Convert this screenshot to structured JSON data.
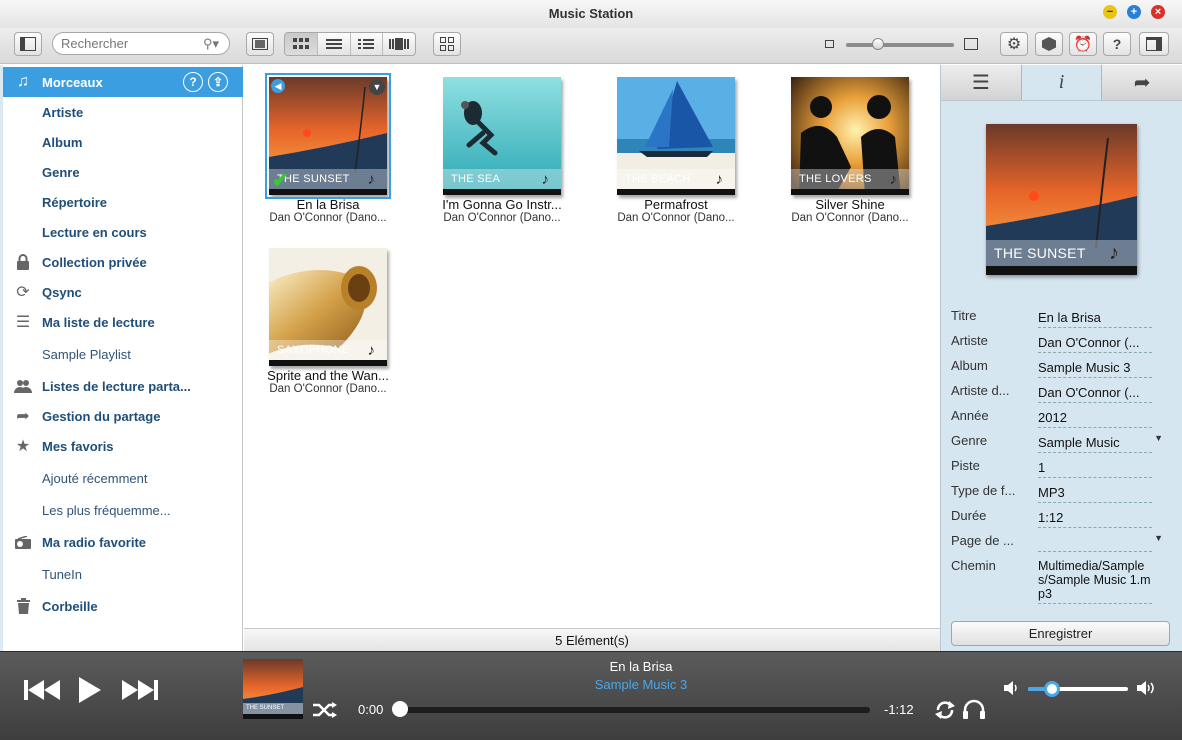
{
  "window": {
    "title": "Music Station"
  },
  "toolbar": {
    "search_placeholder": "Rechercher",
    "view_modes": [
      "thumbnail-view",
      "list-view",
      "detail-list-view",
      "cover-flow-view"
    ],
    "active_view": "thumbnail-view",
    "zoom_level": 0.3
  },
  "sidebar": {
    "items": [
      {
        "label": "Morceaux",
        "icon": "music-note-icon",
        "active": true
      },
      {
        "label": "Artiste"
      },
      {
        "label": "Album"
      },
      {
        "label": "Genre"
      },
      {
        "label": "Répertoire"
      },
      {
        "label": "Lecture en cours"
      },
      {
        "label": "Collection privée",
        "icon": "lock-icon"
      },
      {
        "label": "Qsync",
        "icon": "sync-icon"
      },
      {
        "label": "Ma liste de lecture",
        "icon": "playlist-icon"
      },
      {
        "label": "Sample Playlist",
        "sub": true
      },
      {
        "label": "Listes de lecture parta...",
        "icon": "users-icon"
      },
      {
        "label": "Gestion du partage",
        "icon": "share-icon"
      },
      {
        "label": "Mes favoris",
        "icon": "star-icon"
      },
      {
        "label": "Ajouté récemment",
        "sub": true
      },
      {
        "label": "Les plus fréquemme...",
        "sub": true
      },
      {
        "label": "Ma radio favorite",
        "icon": "radio-icon"
      },
      {
        "label": "TuneIn",
        "sub": true
      },
      {
        "label": "Corbeille",
        "icon": "trash-icon"
      }
    ]
  },
  "tracks": [
    {
      "title": "En la Brisa",
      "artist": "Dan O'Connor (Dano...",
      "cover_caption": "THE SUNSET",
      "selected": true
    },
    {
      "title": "I'm Gonna Go Instr...",
      "artist": "Dan O'Connor (Dano...",
      "cover_caption": "THE SEA"
    },
    {
      "title": "Permafrost",
      "artist": "Dan O'Connor (Dano...",
      "cover_caption": "THE BEACH"
    },
    {
      "title": "Silver Shine",
      "artist": "Dan O'Connor (Dano...",
      "cover_caption": "THE LOVERS"
    },
    {
      "title": "Sprite and the Wan...",
      "artist": "Dan O'Connor (Dano...",
      "cover_caption": "SAXOPHONE"
    }
  ],
  "status": {
    "count_text": "5 Elément(s)"
  },
  "info_panel": {
    "tabs": [
      "list-icon",
      "info-icon",
      "share-arrow-icon"
    ],
    "active_tab": "info-icon",
    "cover_caption": "THE SUNSET",
    "fields": [
      {
        "label": "Titre",
        "value": "En la Brisa"
      },
      {
        "label": "Artiste",
        "value": "Dan O'Connor (..."
      },
      {
        "label": "Album",
        "value": "Sample Music 3"
      },
      {
        "label": "Artiste d...",
        "value": "Dan O'Connor (..."
      },
      {
        "label": "Année",
        "value": "2012"
      },
      {
        "label": "Genre",
        "value": "Sample Music",
        "dropdown": true
      },
      {
        "label": "Piste",
        "value": "1"
      },
      {
        "label": "Type de f...",
        "value": "MP3"
      },
      {
        "label": "Durée",
        "value": "1:12"
      },
      {
        "label": "Page de ...",
        "value": "",
        "dropdown": true
      },
      {
        "label": "Chemin",
        "value": "Multimedia/Samples/Sample Music 1.mp3"
      }
    ],
    "save_label": "Enregistrer"
  },
  "player": {
    "title": "En la Brisa",
    "album": "Sample Music 3",
    "elapsed": "0:00",
    "remaining": "-1:12",
    "progress": 0,
    "volume": 0.24,
    "cover_caption": "THE SUNSET"
  },
  "colors": {
    "accent": "#3b9ee0",
    "player_bg": "#4a4a4a",
    "panel_bg": "#d6e6f0"
  }
}
